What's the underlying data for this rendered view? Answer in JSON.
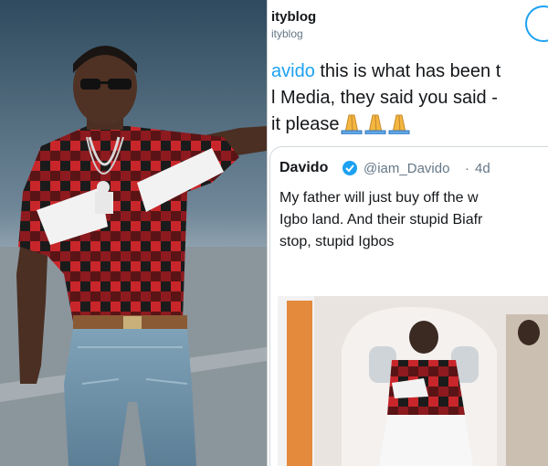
{
  "tweet": {
    "account_name": "ityblog",
    "account_handle": "ityblog",
    "mention": "avido",
    "line1_rest": " this is what has been t",
    "line2": "l Media, they said you said -",
    "line3": "it please",
    "emoji": "praying-hands-icon"
  },
  "quoted_tweet": {
    "author": "Davido",
    "handle": "@iam_Davido",
    "separator": "·",
    "time": "4d",
    "text_line1": "My father will just buy off the w",
    "text_line2": "Igbo land. And their stupid Biafr",
    "text_line3": "stop, stupid Igbos"
  },
  "colors": {
    "link": "#1da1f2",
    "text": "#14171a",
    "muted": "#657786",
    "shirt_red": "#c8262a",
    "verified": "#1da1f2"
  }
}
